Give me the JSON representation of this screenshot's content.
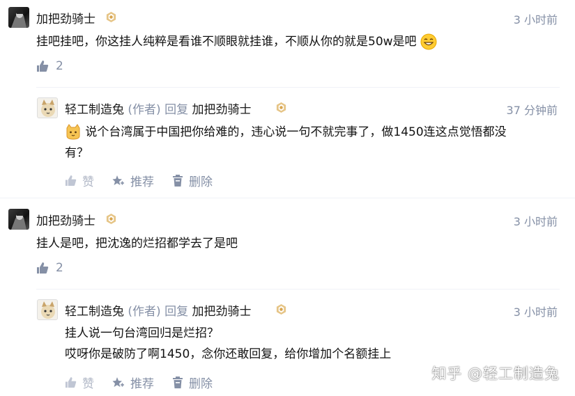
{
  "comments": [
    {
      "author": "加把劲骑士",
      "time": "3 小时前",
      "text": "挂吧挂吧，你这挂人纯粹是看谁不顺眼就挂谁，不顺从你的就是50w是吧",
      "like_count": "2",
      "reply": {
        "author": "轻工制造兔",
        "author_tag": "(作者)",
        "reply_word": "回复",
        "reply_to": "加把劲骑士",
        "time": "37 分钟前",
        "text_line1": "说个台湾属于中国把你给难的，违心说一句不就完事了，做1450连这点觉悟都没",
        "text_line2": "有？",
        "actions": {
          "like": "赞",
          "recommend": "推荐",
          "delete": "删除"
        }
      }
    },
    {
      "author": "加把劲骑士",
      "time": "3 小时前",
      "text": "挂人是吧，把沈逸的烂招都学去了是吧",
      "like_count": "2",
      "reply": {
        "author": "轻工制造兔",
        "author_tag": "(作者)",
        "reply_word": "回复",
        "reply_to": "加把劲骑士",
        "time": "3 小时前",
        "text_line1": "挂人说一句台湾回归是烂招？",
        "text_line2": "哎呀你是破防了啊1450，念你还敢回复，给你增加个名额挂上",
        "actions": {
          "like": "赞",
          "recommend": "推荐",
          "delete": "删除"
        }
      }
    }
  ],
  "watermark": "知乎 @轻工制造兔",
  "colors": {
    "meta": "#8590a6",
    "text": "#121212",
    "badge": "#d9b46e"
  }
}
